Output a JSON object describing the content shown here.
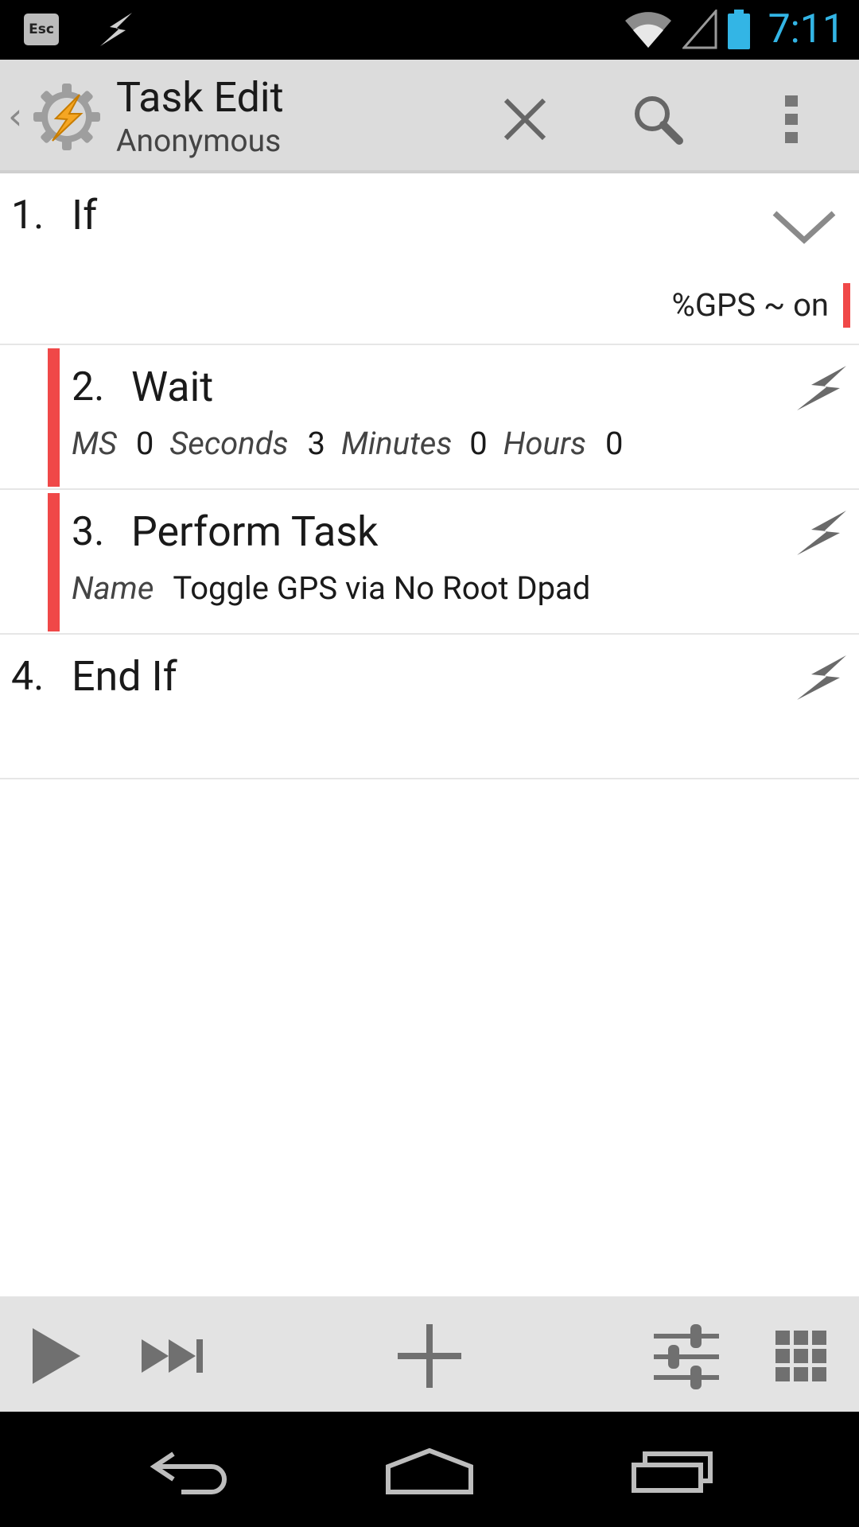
{
  "status_bar": {
    "esc_label": "Esc",
    "time": "7:11",
    "icons": [
      "esc-icon",
      "tasker-bolt-icon",
      "wifi-icon",
      "cell-signal-icon",
      "battery-icon"
    ]
  },
  "action_bar": {
    "title": "Task Edit",
    "subtitle": "Anonymous",
    "icons": [
      "up-chevron-icon",
      "tasker-app-icon",
      "close-icon",
      "search-icon",
      "overflow-menu-icon"
    ]
  },
  "actions": [
    {
      "number": "1.",
      "name": "If",
      "condition": "%GPS ~ on",
      "icon": "chevron-down-icon"
    },
    {
      "number": "2.",
      "name": "Wait",
      "params": [
        {
          "label": "MS",
          "value": "0"
        },
        {
          "label": "Seconds",
          "value": "3"
        },
        {
          "label": "Minutes",
          "value": "0"
        },
        {
          "label": "Hours",
          "value": "0"
        }
      ],
      "icon": "lightning-icon"
    },
    {
      "number": "3.",
      "name": "Perform Task",
      "params": [
        {
          "label": "Name",
          "value": "Toggle GPS via No Root Dpad"
        }
      ],
      "icon": "lightning-icon"
    },
    {
      "number": "4.",
      "name": "End If",
      "icon": "lightning-icon"
    }
  ],
  "bottom_bar": {
    "icons": [
      "play-icon",
      "step-icon",
      "add-icon",
      "settings-sliders-icon",
      "grid-icon"
    ]
  },
  "nav_bar": {
    "icons": [
      "back-icon",
      "home-icon",
      "recents-icon"
    ]
  },
  "colors": {
    "accent_blue": "#33b5e5",
    "red_bar": "#f04848",
    "action_bar_bg": "#dcdcdc",
    "bottom_bar_bg": "#e3e3e3"
  }
}
